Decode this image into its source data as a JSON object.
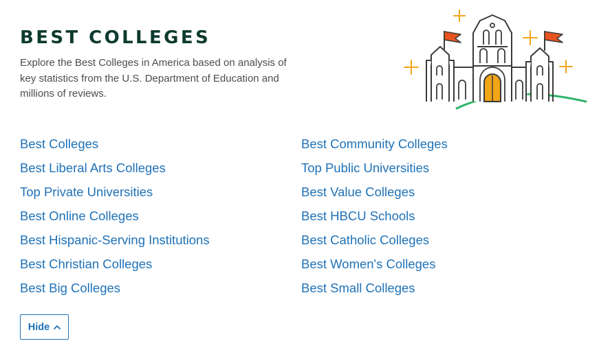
{
  "header": {
    "title": "BEST COLLEGES",
    "description": "Explore the Best Colleges in America based on analysis of key statistics from the U.S. Department of Education and millions of reviews."
  },
  "illustration": {
    "icon": "college-castle-icon",
    "colors": {
      "outline": "#3a3a3a",
      "flag": "#e8531f",
      "door": "#f2a516",
      "sparkle": "#f2a516",
      "hill": "#2fb36a"
    }
  },
  "links": {
    "left": [
      "Best Colleges",
      "Best Liberal Arts Colleges",
      "Top Private Universities",
      "Best Online Colleges",
      "Best Hispanic-Serving Institutions",
      "Best Christian Colleges",
      "Best Big Colleges"
    ],
    "right": [
      "Best Community Colleges",
      "Top Public Universities",
      "Best Value Colleges",
      "Best HBCU Schools",
      "Best Catholic Colleges",
      "Best Women's Colleges",
      "Best Small Colleges"
    ]
  },
  "toggle": {
    "label": "Hide",
    "icon": "chevron-up-icon"
  },
  "colors": {
    "title": "#0e3a2f",
    "link": "#1f72b8",
    "text": "#4c4c4c"
  }
}
